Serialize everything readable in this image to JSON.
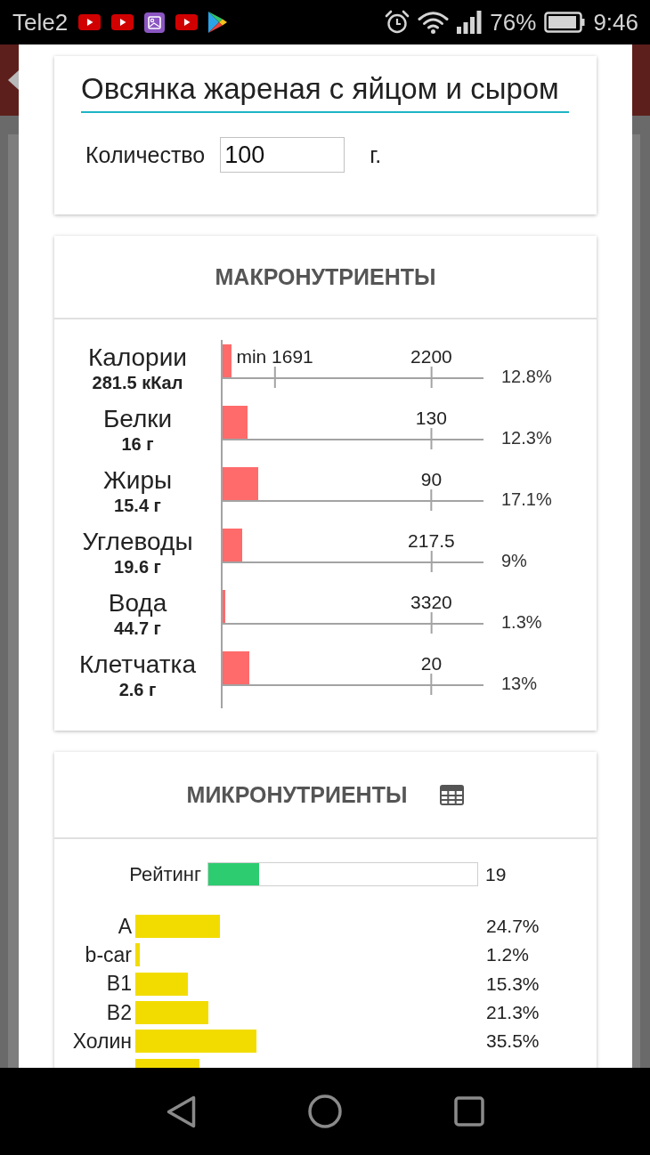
{
  "status_bar": {
    "carrier": "Tele2",
    "battery_percent": "76%",
    "time": "9:46"
  },
  "food_card": {
    "name_field": {
      "value": "Овсянка жареная с яйцом и сыром"
    },
    "quantity": {
      "label": "Количество",
      "value": "100",
      "unit": "г."
    }
  },
  "macronutrients": {
    "title": "МАКРОНУТРИЕНТЫ",
    "rows": [
      {
        "name": "Калории",
        "amount": "281.5 кКал",
        "level": 0.034,
        "markers": [
          {
            "label": "min 1691",
            "level": 0.2
          },
          {
            "label": "2200",
            "level": 0.8
          }
        ],
        "percent": "12.8%"
      },
      {
        "name": "Белки",
        "amount": "16 г",
        "level": 0.095,
        "markers": [
          {
            "label": "130",
            "level": 0.8
          }
        ],
        "percent": "12.3%"
      },
      {
        "name": "Жиры",
        "amount": "15.4 г",
        "level": 0.136,
        "markers": [
          {
            "label": "90",
            "level": 0.8
          }
        ],
        "percent": "17.1%"
      },
      {
        "name": "Углеводы",
        "amount": "19.6 г",
        "level": 0.075,
        "markers": [
          {
            "label": "217.5",
            "level": 0.8
          }
        ],
        "percent": "9%"
      },
      {
        "name": "Вода",
        "amount": "44.7 г",
        "level": 0.01,
        "markers": [
          {
            "label": "3320",
            "level": 0.8
          }
        ],
        "percent": "1.3%"
      },
      {
        "name": "Клетчатка",
        "amount": "2.6 г",
        "level": 0.102,
        "markers": [
          {
            "label": "20",
            "level": 0.8
          }
        ],
        "percent": "13%"
      }
    ]
  },
  "micronutrients": {
    "title": "МИКРОНУТРИЕНТЫ",
    "rating": {
      "label": "Рейтинг",
      "level": 0.19,
      "value": "19"
    },
    "rows": [
      {
        "name": "A",
        "level": 0.247,
        "percent": "24.7%"
      },
      {
        "name": "b-car",
        "level": 0.012,
        "percent": "1.2%"
      },
      {
        "name": "B1",
        "level": 0.153,
        "percent": "15.3%"
      },
      {
        "name": "B2",
        "level": 0.213,
        "percent": "21.3%"
      },
      {
        "name": "Холин",
        "level": 0.355,
        "percent": "35.5%"
      },
      {
        "level": 0.187
      }
    ]
  }
}
